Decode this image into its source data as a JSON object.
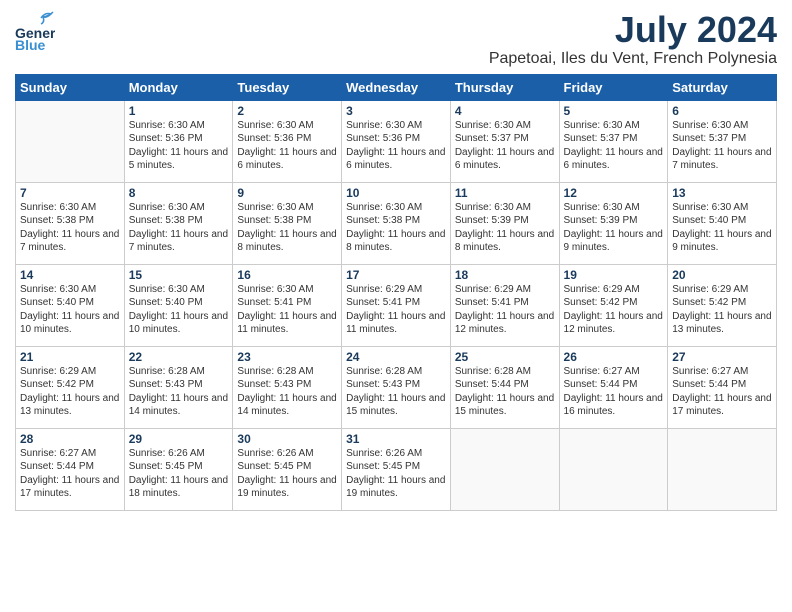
{
  "header": {
    "logo_general": "General",
    "logo_blue": "Blue",
    "month": "July 2024",
    "location": "Papetoai, Iles du Vent, French Polynesia"
  },
  "days_of_week": [
    "Sunday",
    "Monday",
    "Tuesday",
    "Wednesday",
    "Thursday",
    "Friday",
    "Saturday"
  ],
  "weeks": [
    [
      {
        "day": "",
        "sunrise": "",
        "sunset": "",
        "daylight": ""
      },
      {
        "day": "1",
        "sunrise": "Sunrise: 6:30 AM",
        "sunset": "Sunset: 5:36 PM",
        "daylight": "Daylight: 11 hours and 5 minutes."
      },
      {
        "day": "2",
        "sunrise": "Sunrise: 6:30 AM",
        "sunset": "Sunset: 5:36 PM",
        "daylight": "Daylight: 11 hours and 6 minutes."
      },
      {
        "day": "3",
        "sunrise": "Sunrise: 6:30 AM",
        "sunset": "Sunset: 5:36 PM",
        "daylight": "Daylight: 11 hours and 6 minutes."
      },
      {
        "day": "4",
        "sunrise": "Sunrise: 6:30 AM",
        "sunset": "Sunset: 5:37 PM",
        "daylight": "Daylight: 11 hours and 6 minutes."
      },
      {
        "day": "5",
        "sunrise": "Sunrise: 6:30 AM",
        "sunset": "Sunset: 5:37 PM",
        "daylight": "Daylight: 11 hours and 6 minutes."
      },
      {
        "day": "6",
        "sunrise": "Sunrise: 6:30 AM",
        "sunset": "Sunset: 5:37 PM",
        "daylight": "Daylight: 11 hours and 7 minutes."
      }
    ],
    [
      {
        "day": "7",
        "sunrise": "Sunrise: 6:30 AM",
        "sunset": "Sunset: 5:38 PM",
        "daylight": "Daylight: 11 hours and 7 minutes."
      },
      {
        "day": "8",
        "sunrise": "Sunrise: 6:30 AM",
        "sunset": "Sunset: 5:38 PM",
        "daylight": "Daylight: 11 hours and 7 minutes."
      },
      {
        "day": "9",
        "sunrise": "Sunrise: 6:30 AM",
        "sunset": "Sunset: 5:38 PM",
        "daylight": "Daylight: 11 hours and 8 minutes."
      },
      {
        "day": "10",
        "sunrise": "Sunrise: 6:30 AM",
        "sunset": "Sunset: 5:38 PM",
        "daylight": "Daylight: 11 hours and 8 minutes."
      },
      {
        "day": "11",
        "sunrise": "Sunrise: 6:30 AM",
        "sunset": "Sunset: 5:39 PM",
        "daylight": "Daylight: 11 hours and 8 minutes."
      },
      {
        "day": "12",
        "sunrise": "Sunrise: 6:30 AM",
        "sunset": "Sunset: 5:39 PM",
        "daylight": "Daylight: 11 hours and 9 minutes."
      },
      {
        "day": "13",
        "sunrise": "Sunrise: 6:30 AM",
        "sunset": "Sunset: 5:40 PM",
        "daylight": "Daylight: 11 hours and 9 minutes."
      }
    ],
    [
      {
        "day": "14",
        "sunrise": "Sunrise: 6:30 AM",
        "sunset": "Sunset: 5:40 PM",
        "daylight": "Daylight: 11 hours and 10 minutes."
      },
      {
        "day": "15",
        "sunrise": "Sunrise: 6:30 AM",
        "sunset": "Sunset: 5:40 PM",
        "daylight": "Daylight: 11 hours and 10 minutes."
      },
      {
        "day": "16",
        "sunrise": "Sunrise: 6:30 AM",
        "sunset": "Sunset: 5:41 PM",
        "daylight": "Daylight: 11 hours and 11 minutes."
      },
      {
        "day": "17",
        "sunrise": "Sunrise: 6:29 AM",
        "sunset": "Sunset: 5:41 PM",
        "daylight": "Daylight: 11 hours and 11 minutes."
      },
      {
        "day": "18",
        "sunrise": "Sunrise: 6:29 AM",
        "sunset": "Sunset: 5:41 PM",
        "daylight": "Daylight: 11 hours and 12 minutes."
      },
      {
        "day": "19",
        "sunrise": "Sunrise: 6:29 AM",
        "sunset": "Sunset: 5:42 PM",
        "daylight": "Daylight: 11 hours and 12 minutes."
      },
      {
        "day": "20",
        "sunrise": "Sunrise: 6:29 AM",
        "sunset": "Sunset: 5:42 PM",
        "daylight": "Daylight: 11 hours and 13 minutes."
      }
    ],
    [
      {
        "day": "21",
        "sunrise": "Sunrise: 6:29 AM",
        "sunset": "Sunset: 5:42 PM",
        "daylight": "Daylight: 11 hours and 13 minutes."
      },
      {
        "day": "22",
        "sunrise": "Sunrise: 6:28 AM",
        "sunset": "Sunset: 5:43 PM",
        "daylight": "Daylight: 11 hours and 14 minutes."
      },
      {
        "day": "23",
        "sunrise": "Sunrise: 6:28 AM",
        "sunset": "Sunset: 5:43 PM",
        "daylight": "Daylight: 11 hours and 14 minutes."
      },
      {
        "day": "24",
        "sunrise": "Sunrise: 6:28 AM",
        "sunset": "Sunset: 5:43 PM",
        "daylight": "Daylight: 11 hours and 15 minutes."
      },
      {
        "day": "25",
        "sunrise": "Sunrise: 6:28 AM",
        "sunset": "Sunset: 5:44 PM",
        "daylight": "Daylight: 11 hours and 15 minutes."
      },
      {
        "day": "26",
        "sunrise": "Sunrise: 6:27 AM",
        "sunset": "Sunset: 5:44 PM",
        "daylight": "Daylight: 11 hours and 16 minutes."
      },
      {
        "day": "27",
        "sunrise": "Sunrise: 6:27 AM",
        "sunset": "Sunset: 5:44 PM",
        "daylight": "Daylight: 11 hours and 17 minutes."
      }
    ],
    [
      {
        "day": "28",
        "sunrise": "Sunrise: 6:27 AM",
        "sunset": "Sunset: 5:44 PM",
        "daylight": "Daylight: 11 hours and 17 minutes."
      },
      {
        "day": "29",
        "sunrise": "Sunrise: 6:26 AM",
        "sunset": "Sunset: 5:45 PM",
        "daylight": "Daylight: 11 hours and 18 minutes."
      },
      {
        "day": "30",
        "sunrise": "Sunrise: 6:26 AM",
        "sunset": "Sunset: 5:45 PM",
        "daylight": "Daylight: 11 hours and 19 minutes."
      },
      {
        "day": "31",
        "sunrise": "Sunrise: 6:26 AM",
        "sunset": "Sunset: 5:45 PM",
        "daylight": "Daylight: 11 hours and 19 minutes."
      },
      {
        "day": "",
        "sunrise": "",
        "sunset": "",
        "daylight": ""
      },
      {
        "day": "",
        "sunrise": "",
        "sunset": "",
        "daylight": ""
      },
      {
        "day": "",
        "sunrise": "",
        "sunset": "",
        "daylight": ""
      }
    ]
  ]
}
